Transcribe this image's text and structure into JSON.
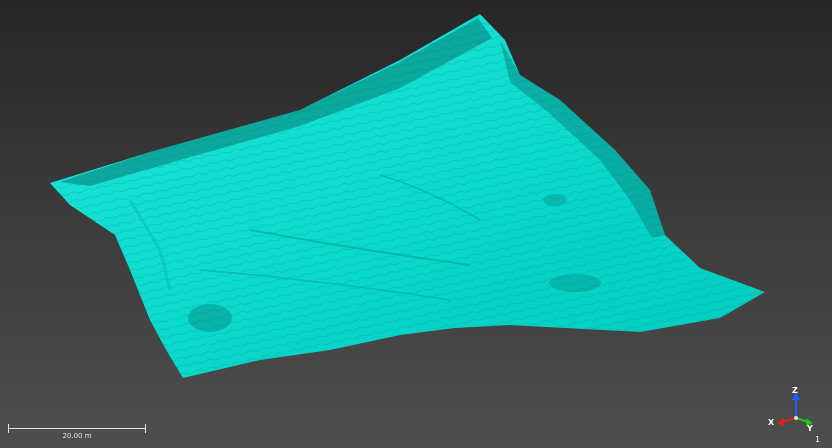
{
  "viewer": {
    "background_top": "#262626",
    "background_bottom": "#4e4e4e",
    "mesh_color": "#00e5d8"
  },
  "scale_bar": {
    "label": "20.00 m"
  },
  "axes": {
    "x": "X",
    "y": "Y",
    "z": "Z",
    "colors": {
      "x": "#e02020",
      "y": "#20c020",
      "z": "#2060ff"
    }
  },
  "indicator": {
    "text": "1"
  }
}
